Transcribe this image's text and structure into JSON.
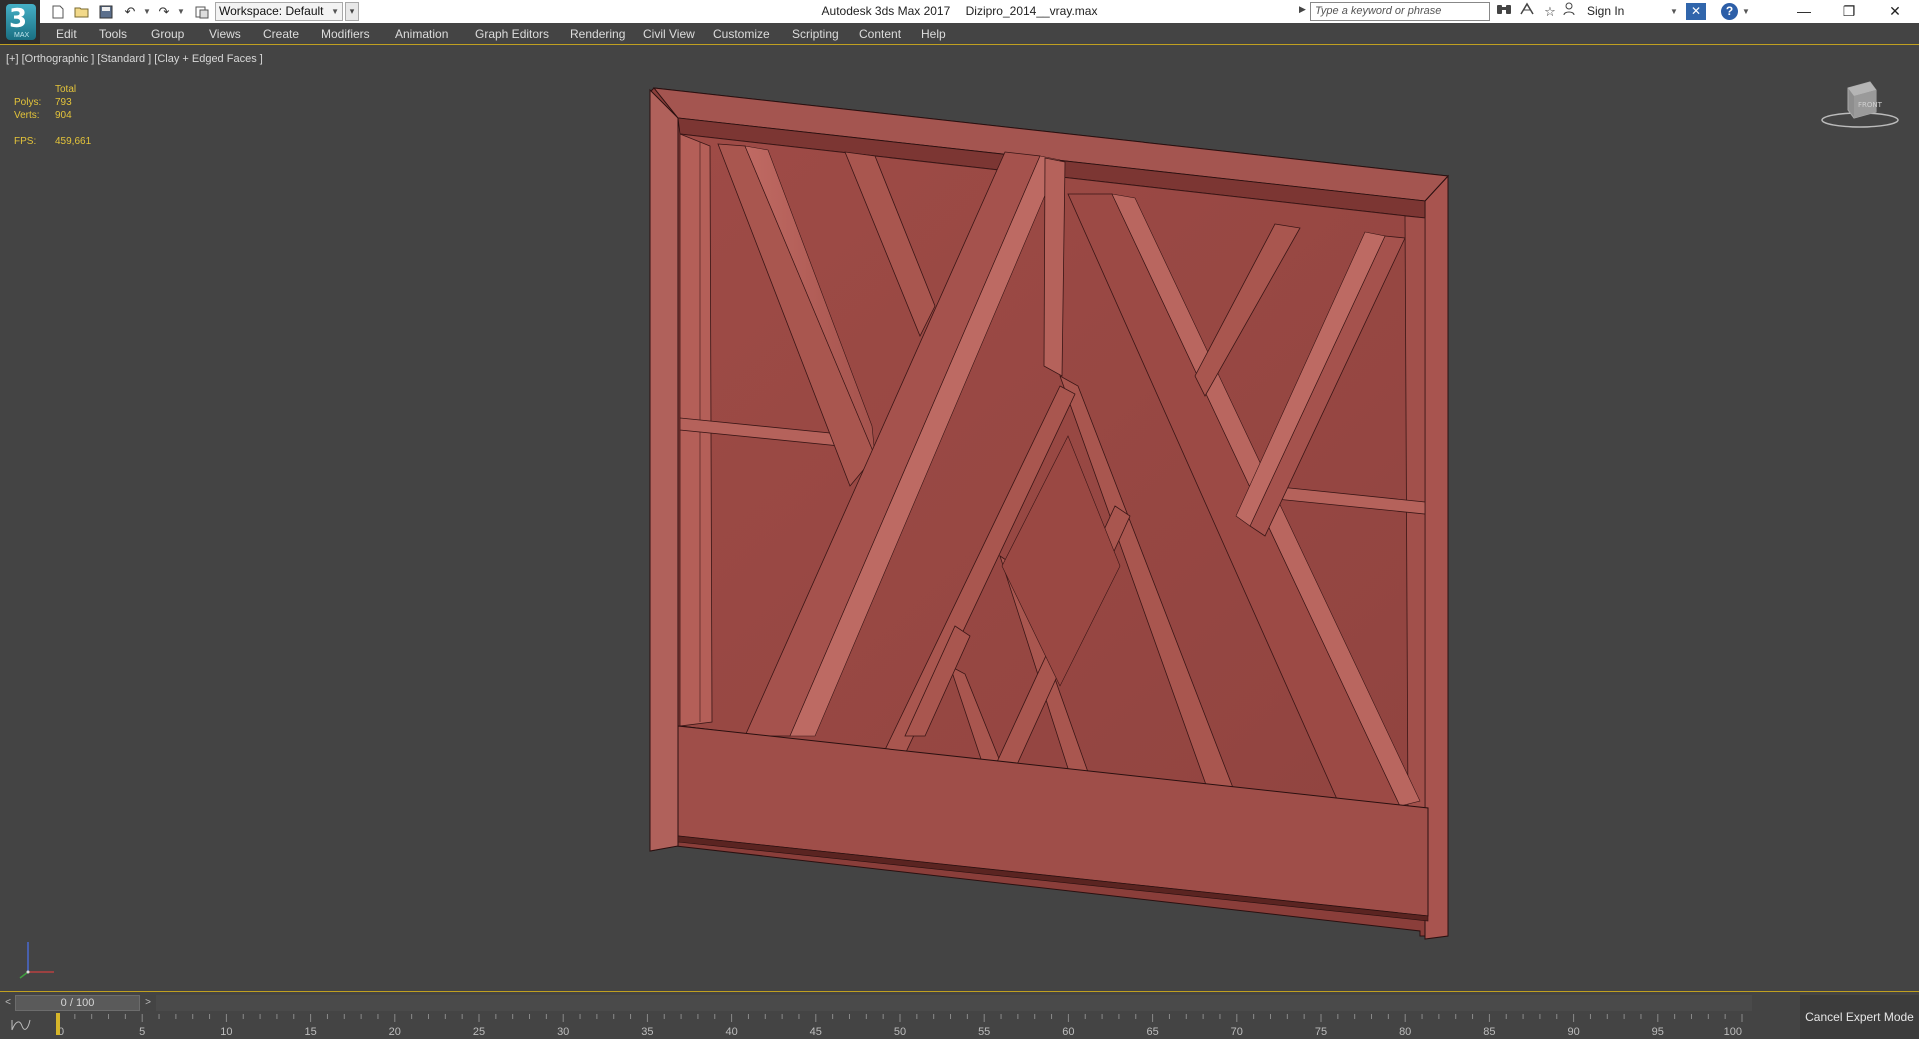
{
  "app": {
    "logo_text": "3",
    "logo_sub": "MAX",
    "title": "Autodesk 3ds Max 2017",
    "file": "Dizipro_2014__vray.max",
    "workspace": "Workspace: Default"
  },
  "search": {
    "placeholder": "Type a keyword or phrase"
  },
  "account": {
    "sign_in": "Sign In"
  },
  "menu": [
    "Edit",
    "Tools",
    "Group",
    "Views",
    "Create",
    "Modifiers",
    "Animation",
    "Graph Editors",
    "Rendering",
    "Civil View",
    "Customize",
    "Scripting",
    "Content",
    "Help"
  ],
  "viewport": {
    "label": "[+] [Orthographic ] [Standard ] [Clay + Edged Faces ]",
    "stats": {
      "header": "Total",
      "polys_label": "Polys:",
      "polys": "793",
      "verts_label": "Verts:",
      "verts": "904",
      "fps_label": "FPS:",
      "fps": "459,661"
    },
    "viewcube_label": "FRONT",
    "model_color": "#9b4a45"
  },
  "timeline": {
    "frame": "0 / 100",
    "ticks": [
      "0",
      "5",
      "10",
      "15",
      "20",
      "25",
      "30",
      "35",
      "40",
      "45",
      "50",
      "55",
      "60",
      "65",
      "70",
      "75",
      "80",
      "85",
      "90",
      "95",
      "100"
    ]
  },
  "status": {
    "expert_mode": "Cancel Expert Mode"
  },
  "colors": {
    "accent": "#c0a020",
    "stats_text": "#e4c43a",
    "viewport_bg": "#444444",
    "model_base": "#9b4a45"
  }
}
